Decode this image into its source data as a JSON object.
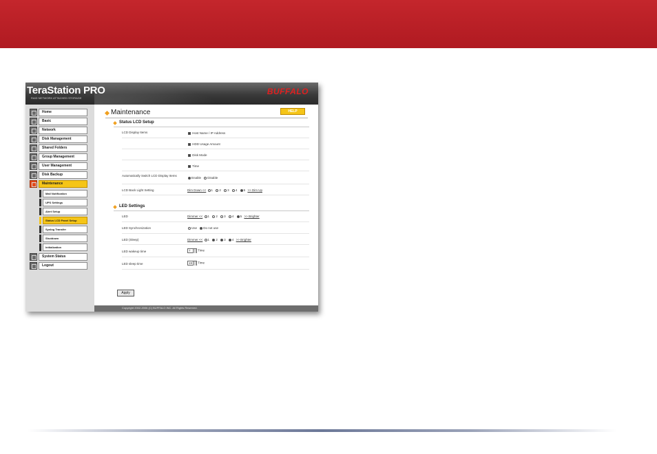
{
  "window": {
    "brand_name": "TeraStation PRO",
    "brand_subtitle": "RAID NETWORK ATTACHED STORAGE",
    "logo_text": "BUFFALO"
  },
  "sidebar": {
    "items": [
      {
        "label": "Home"
      },
      {
        "label": "Basic"
      },
      {
        "label": "Network"
      },
      {
        "label": "Disk Management"
      },
      {
        "label": "Shared Folders"
      },
      {
        "label": "Group Management"
      },
      {
        "label": "User Management"
      },
      {
        "label": "Disk Backup"
      },
      {
        "label": "Maintenance"
      }
    ],
    "subitems": [
      {
        "label": "Mail Notification"
      },
      {
        "label": "UPS Settings"
      },
      {
        "label": "Alert Setup"
      },
      {
        "label": "Status LCD Panel Setup"
      },
      {
        "label": "Syslog Transfer"
      },
      {
        "label": "Shutdown"
      },
      {
        "label": "Initialization"
      }
    ],
    "bottom_items": [
      {
        "label": "System Status"
      },
      {
        "label": "Logout"
      }
    ]
  },
  "main": {
    "title": "Maintenance",
    "help_label": "HELP",
    "lcd_section": {
      "title": "Status LCD Setup",
      "display_items_label": "LCD Display Items",
      "checkboxes": [
        {
          "label": "Host Name / IP Address"
        },
        {
          "label": "HDD Usage Amount"
        },
        {
          "label": "Disk Mode"
        },
        {
          "label": "Time"
        }
      ],
      "auto_switch_label": "Automatically Switch LCD Display Items",
      "auto_switch_options": {
        "enable": "Enable",
        "disable": "Disable"
      },
      "backlight_label": "LCD Back Light Setting",
      "backlight_down": "Dim Down <<",
      "backlight_up": ">> Dim Up",
      "backlight_options": [
        "1",
        "2",
        "3",
        "4",
        "5"
      ]
    },
    "led_section": {
      "title": "LED Settings",
      "led_label": "LED",
      "dimmer": "Dimmer <<",
      "brighter": ">> Brighter",
      "led_options": [
        "1",
        "2",
        "3",
        "4",
        "5"
      ],
      "sync_label": "LED Synchronization",
      "sync_options": {
        "use": "Use",
        "do_not_use": "Do not use"
      },
      "sleep_label": "LED (Sleep)",
      "sleep_options": [
        "1",
        "2",
        "3",
        "4"
      ],
      "wakeup_label": "LED wakeup time",
      "wakeup_value": "7",
      "sleep_time_label": "LED sleep time",
      "sleep_time_value": "19",
      "time_unit": "Time"
    },
    "apply_label": "Apply"
  },
  "footer": {
    "copyright": "Copyright 2002-2006 (C) BUFFALO INC. All Rights Reserved."
  },
  "colors": {
    "banner_red": "#c4262c",
    "active_yellow": "#f5c518",
    "active_orange": "#e34a1a",
    "header_dark": "#3a3a3a"
  }
}
